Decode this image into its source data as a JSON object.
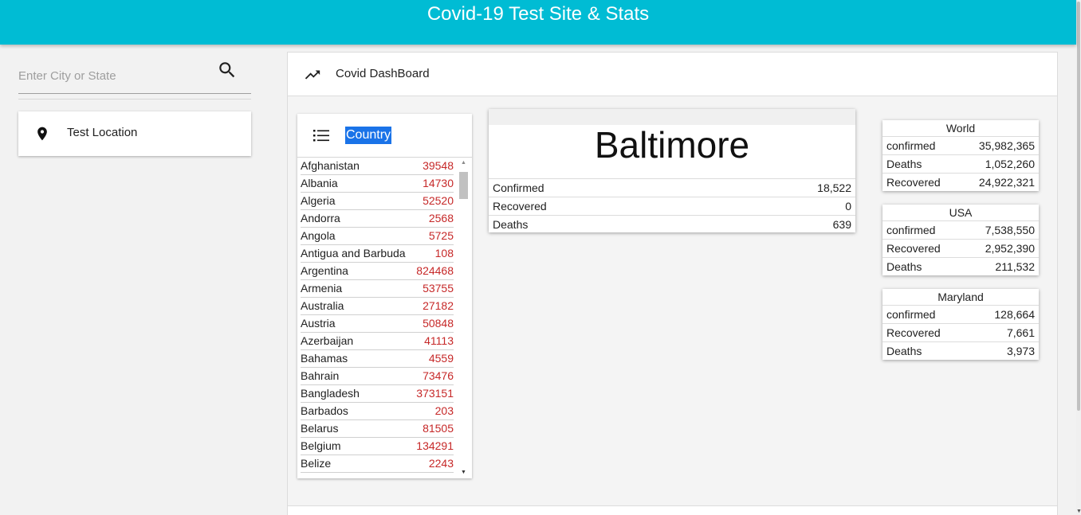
{
  "app": {
    "title": "Covid-19 Test Site & Stats"
  },
  "sidebar": {
    "search": {
      "placeholder": "Enter City or State",
      "value": "",
      "icon": "search-icon"
    },
    "locations": [
      {
        "label": "Test Location",
        "icon": "location-pin-icon"
      }
    ]
  },
  "dashboard": {
    "title": "Covid DashBoard",
    "icon": "trending-up-icon",
    "country_list": {
      "header": "Country",
      "header_icon": "list-icon",
      "rows": [
        {
          "name": "Afghanistan",
          "value": "39548"
        },
        {
          "name": "Albania",
          "value": "14730"
        },
        {
          "name": "Algeria",
          "value": "52520"
        },
        {
          "name": "Andorra",
          "value": "2568"
        },
        {
          "name": "Angola",
          "value": "5725"
        },
        {
          "name": "Antigua and Barbuda",
          "value": "108"
        },
        {
          "name": "Argentina",
          "value": "824468"
        },
        {
          "name": "Armenia",
          "value": "53755"
        },
        {
          "name": "Australia",
          "value": "27182"
        },
        {
          "name": "Austria",
          "value": "50848"
        },
        {
          "name": "Azerbaijan",
          "value": "41113"
        },
        {
          "name": "Bahamas",
          "value": "4559"
        },
        {
          "name": "Bahrain",
          "value": "73476"
        },
        {
          "name": "Bangladesh",
          "value": "373151"
        },
        {
          "name": "Barbados",
          "value": "203"
        },
        {
          "name": "Belarus",
          "value": "81505"
        },
        {
          "name": "Belgium",
          "value": "134291"
        },
        {
          "name": "Belize",
          "value": "2243"
        }
      ]
    },
    "city": {
      "name": "Baltimore",
      "rows": [
        {
          "label": "Confirmed",
          "value": "18,522"
        },
        {
          "label": "Recovered",
          "value": "0"
        },
        {
          "label": "Deaths",
          "value": "639"
        }
      ]
    },
    "stat_cards": [
      {
        "title": "World",
        "rows": [
          {
            "label": "confirmed",
            "value": "35,982,365"
          },
          {
            "label": "Deaths",
            "value": "1,052,260"
          },
          {
            "label": "Recovered",
            "value": "24,922,321"
          }
        ]
      },
      {
        "title": "USA",
        "rows": [
          {
            "label": "confirmed",
            "value": "7,538,550"
          },
          {
            "label": "Recovered",
            "value": "2,952,390"
          },
          {
            "label": "Deaths",
            "value": "211,532"
          }
        ]
      },
      {
        "title": "Maryland",
        "rows": [
          {
            "label": "confirmed",
            "value": "128,664"
          },
          {
            "label": "Recovered",
            "value": "7,661"
          },
          {
            "label": "Deaths",
            "value": "3,973"
          }
        ]
      }
    ]
  },
  "colors": {
    "header": "#00bcd4",
    "value_text": "#c62828",
    "selection": "#1a73e8"
  }
}
